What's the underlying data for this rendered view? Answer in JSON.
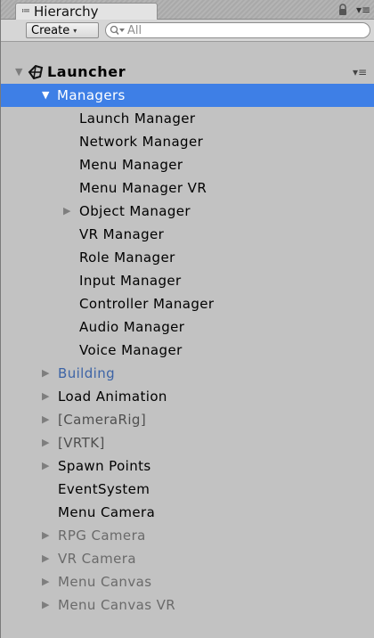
{
  "panel": {
    "tab_label": "Hierarchy",
    "tab_icon": "≔",
    "lock_icon": "lock-icon",
    "menu_glyph": "▾≡"
  },
  "toolbar": {
    "create_label": "Create",
    "create_caret": "▾",
    "search_placeholder": "All"
  },
  "tree": {
    "root": {
      "label": "Launcher",
      "expanded": true,
      "menu_glyph": "▾≡"
    },
    "managers": {
      "label": "Managers",
      "expanded": true,
      "selected": true
    },
    "manager_items": [
      "Launch Manager",
      "Network Manager",
      "Menu Manager",
      "Menu Manager VR",
      "Object Manager",
      "VR Manager",
      "Role Manager",
      "Input Manager",
      "Controller Manager",
      "Audio Manager",
      "Voice Manager"
    ],
    "top_items": [
      "Building",
      "Load Animation",
      "[CameraRig]",
      "[VRTK]",
      "Spawn Points",
      "EventSystem",
      "Menu Camera",
      "RPG Camera",
      "VR Camera",
      "Menu Canvas",
      "Menu Canvas VR"
    ],
    "arrow_collapsed": "▶",
    "arrow_expanded": "▼"
  },
  "colors": {
    "selection": "#3e7fe6",
    "prefab_text": "#3d64a6",
    "inactive_text": "#6a6a6a",
    "panel_bg": "#c2c2c2"
  }
}
